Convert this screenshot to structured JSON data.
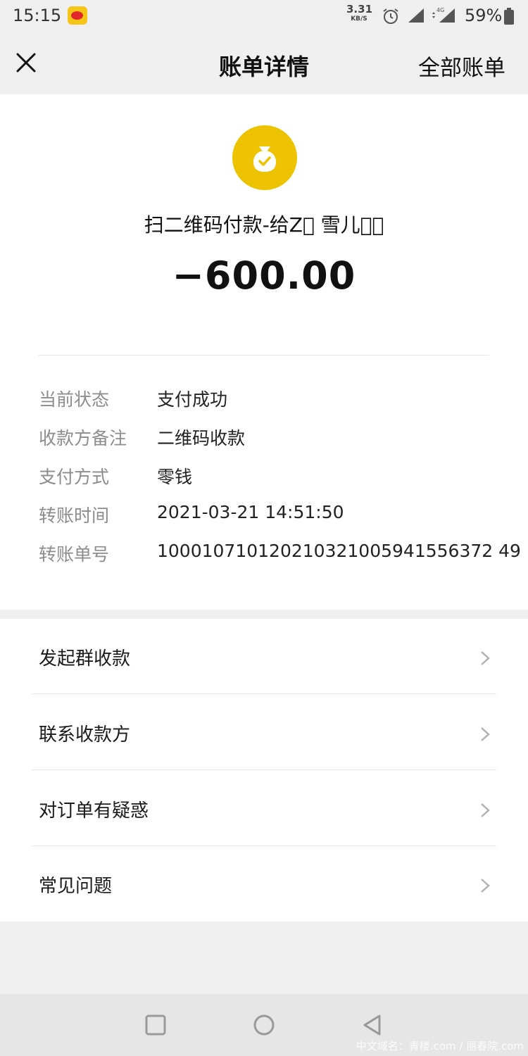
{
  "status_bar": {
    "time": "15:15",
    "speed_value": "3.31",
    "speed_unit": "KB/S",
    "network": "4G",
    "battery": "59%"
  },
  "nav": {
    "title": "账单详情",
    "all_bills": "全部账单"
  },
  "summary": {
    "merchant": "扫二维码付款-给Z\u0000 雪儿\u0000\u0000",
    "amount": "−600.00",
    "icon": "coin-bag-check-icon",
    "icon_color": "#edc200"
  },
  "details": [
    {
      "label": "当前状态",
      "value": "支付成功"
    },
    {
      "label": "收款方备注",
      "value": "二维码收款"
    },
    {
      "label": "支付方式",
      "value": "零钱"
    },
    {
      "label": "转账时间",
      "value": "2021-03-21 14:51:50"
    },
    {
      "label": "转账单号",
      "value": "100010710120210321005941556372 49"
    }
  ],
  "actions": [
    {
      "label": "发起群收款"
    },
    {
      "label": "联系收款方"
    },
    {
      "label": "对订单有疑惑"
    },
    {
      "label": "常见问题"
    }
  ],
  "watermark": "中文域名：青楼.com / 丽春院.com"
}
